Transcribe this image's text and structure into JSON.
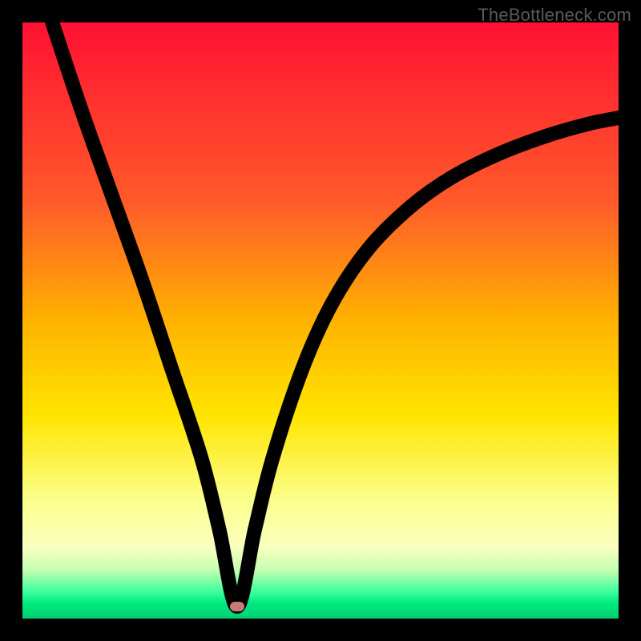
{
  "watermark": "TheBottleneck.com",
  "chart_data": {
    "type": "line",
    "title": "",
    "xlabel": "",
    "ylabel": "",
    "xlim": [
      0,
      100
    ],
    "ylim": [
      0,
      100
    ],
    "grid": false,
    "legend": false,
    "marker": {
      "x": 36,
      "y": 2
    },
    "series": [
      {
        "name": "bottleneck-curve",
        "x": [
          5,
          10,
          15,
          20,
          25,
          30,
          33,
          36,
          39,
          42,
          47,
          52,
          58,
          65,
          72,
          80,
          88,
          95,
          100
        ],
        "values": [
          100,
          85,
          71,
          57,
          42,
          27,
          15,
          2,
          15,
          27,
          42,
          53,
          62,
          69,
          74,
          78,
          81,
          83,
          84
        ]
      }
    ],
    "gradient_stops": [
      {
        "pct": 0,
        "color": "#ff1133"
      },
      {
        "pct": 30,
        "color": "#ff5a2a"
      },
      {
        "pct": 50,
        "color": "#ffb200"
      },
      {
        "pct": 66,
        "color": "#ffe500"
      },
      {
        "pct": 80,
        "color": "#fbff8a"
      },
      {
        "pct": 88,
        "color": "#faffc0"
      },
      {
        "pct": 92,
        "color": "#c2ffb0"
      },
      {
        "pct": 95.5,
        "color": "#3cff9e"
      },
      {
        "pct": 97.5,
        "color": "#00e97f"
      },
      {
        "pct": 100,
        "color": "#00d072"
      }
    ]
  }
}
